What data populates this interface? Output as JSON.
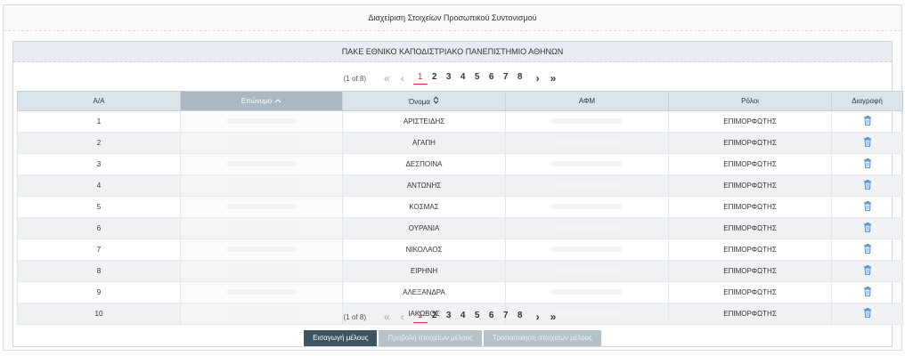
{
  "panel_title": "Διαχείριση Στοιχείων Προσωπικού Συντονισμού",
  "org_title": "ΠΑΚΕ ΕΘΝΙΚΟ ΚΑΠΟΔΙΣΤΡΙΑΚΟ ΠΑΝΕΠΙΣΤΗΜΙΟ ΑΘΗΝΩΝ",
  "pager": {
    "info": "(1 of 8)",
    "first": "«",
    "prev": "‹",
    "next": "›",
    "last": "»",
    "pages": [
      "1",
      "2",
      "3",
      "4",
      "5",
      "6",
      "7",
      "8"
    ],
    "current": "1"
  },
  "columns": {
    "aa": "Α/Α",
    "surname": "Επώνυμο",
    "name": "Όνομα",
    "afm": "ΑΦΜ",
    "roles": "Ρόλοι",
    "delete": "Διαγραφή"
  },
  "rows": [
    {
      "aa": "1",
      "name": "ΑΡΙΣΤΕΙΔΗΣ",
      "role": "ΕΠΙΜΟΡΦΩΤΗΣ"
    },
    {
      "aa": "2",
      "name": "ΑΓΑΠΗ",
      "role": "ΕΠΙΜΟΡΦΩΤΗΣ"
    },
    {
      "aa": "3",
      "name": "ΔΕΣΠΟΙΝΑ",
      "role": "ΕΠΙΜΟΡΦΩΤΗΣ"
    },
    {
      "aa": "4",
      "name": "ΑΝΤΩΝΗΣ",
      "role": "ΕΠΙΜΟΡΦΩΤΗΣ"
    },
    {
      "aa": "5",
      "name": "ΚΟΣΜΑΣ",
      "role": "ΕΠΙΜΟΡΦΩΤΗΣ"
    },
    {
      "aa": "6",
      "name": "ΟΥΡΑΝΙΑ",
      "role": "ΕΠΙΜΟΡΦΩΤΗΣ"
    },
    {
      "aa": "7",
      "name": "ΝΙΚΟΛΑΟΣ",
      "role": "ΕΠΙΜΟΡΦΩΤΗΣ"
    },
    {
      "aa": "8",
      "name": "ΕΙΡΗΝΗ",
      "role": "ΕΠΙΜΟΡΦΩΤΗΣ"
    },
    {
      "aa": "9",
      "name": "ΑΛΕΞΑΝΔΡΑ",
      "role": "ΕΠΙΜΟΡΦΩΤΗΣ"
    },
    {
      "aa": "10",
      "name": "ΙΑΚΩΒΟΣ",
      "role": "ΕΠΙΜΟΡΦΩΤΗΣ"
    }
  ],
  "buttons": {
    "add": "Εισαγωγή μέλους",
    "view": "Προβολή στοιχείων μέλους",
    "edit": "Τροποποίηση στοιχείων μέλους"
  },
  "colors": {
    "accent": "#3f5461",
    "active_page": "#c0392b",
    "trash": "#5b8fc7"
  },
  "icons": {
    "sort_asc": "chevron-up-icon",
    "sort_both": "sort-icon",
    "delete": "trash-icon"
  }
}
